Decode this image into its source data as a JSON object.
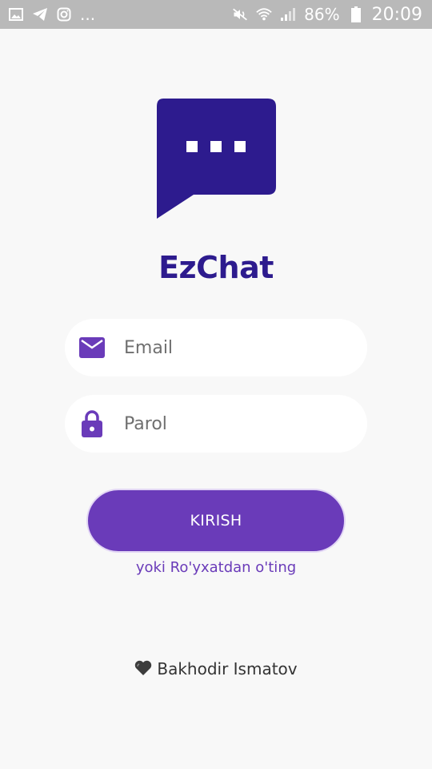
{
  "status_bar": {
    "left_icons": [
      "image-icon",
      "telegram-icon",
      "instagram-icon"
    ],
    "overflow": "...",
    "battery_percent": "86%",
    "time": "20:09"
  },
  "app": {
    "title": "EzChat"
  },
  "login_form": {
    "email_placeholder": "Email",
    "password_placeholder": "Parol",
    "submit_label": "KIRISH",
    "register_link": "yoki Ro'yxatdan o'ting"
  },
  "footer": {
    "author": "Bakhodir Ismatov"
  },
  "colors": {
    "primary": "#6a3bb9",
    "logo": "#2d1b8e",
    "status_bar": "#b9b9b9",
    "background": "#f8f8f8"
  }
}
